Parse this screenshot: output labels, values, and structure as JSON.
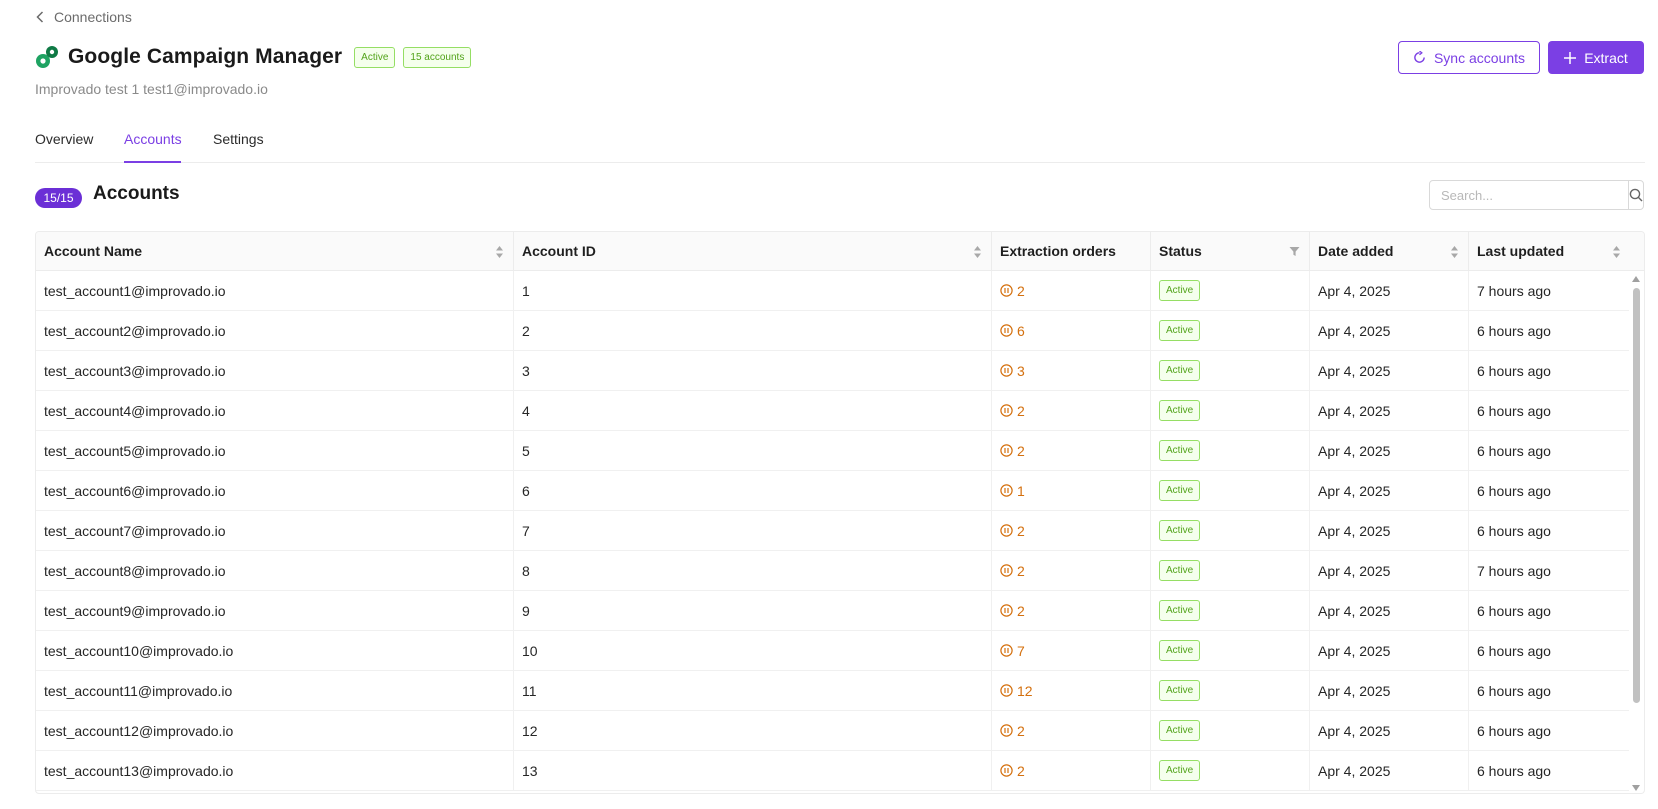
{
  "breadcrumb": {
    "label": "Connections"
  },
  "connector": {
    "title": "Google Campaign Manager",
    "status_badge": "Active",
    "accounts_badge": "15 accounts",
    "subtitle": "Improvado test 1 test1@improvado.io"
  },
  "actions": {
    "sync_label": "Sync accounts",
    "extract_label": "Extract"
  },
  "tabs": [
    {
      "label": "Overview",
      "active": false
    },
    {
      "label": "Accounts",
      "active": true
    },
    {
      "label": "Settings",
      "active": false
    }
  ],
  "section": {
    "count": "15/15",
    "title": "Accounts"
  },
  "search": {
    "placeholder": "Search...",
    "value": ""
  },
  "table": {
    "columns": [
      "Account Name",
      "Account ID",
      "Extraction orders",
      "Status",
      "Date added",
      "Last updated"
    ],
    "rows": [
      {
        "name": "test_account1@improvado.io",
        "id": "1",
        "orders": "2",
        "status": "Active",
        "added": "Apr 4, 2025",
        "updated": "7 hours ago"
      },
      {
        "name": "test_account2@improvado.io",
        "id": "2",
        "orders": "6",
        "status": "Active",
        "added": "Apr 4, 2025",
        "updated": "6 hours ago"
      },
      {
        "name": "test_account3@improvado.io",
        "id": "3",
        "orders": "3",
        "status": "Active",
        "added": "Apr 4, 2025",
        "updated": "6 hours ago"
      },
      {
        "name": "test_account4@improvado.io",
        "id": "4",
        "orders": "2",
        "status": "Active",
        "added": "Apr 4, 2025",
        "updated": "6 hours ago"
      },
      {
        "name": "test_account5@improvado.io",
        "id": "5",
        "orders": "2",
        "status": "Active",
        "added": "Apr 4, 2025",
        "updated": "6 hours ago"
      },
      {
        "name": "test_account6@improvado.io",
        "id": "6",
        "orders": "1",
        "status": "Active",
        "added": "Apr 4, 2025",
        "updated": "6 hours ago"
      },
      {
        "name": "test_account7@improvado.io",
        "id": "7",
        "orders": "2",
        "status": "Active",
        "added": "Apr 4, 2025",
        "updated": "6 hours ago"
      },
      {
        "name": "test_account8@improvado.io",
        "id": "8",
        "orders": "2",
        "status": "Active",
        "added": "Apr 4, 2025",
        "updated": "7 hours ago"
      },
      {
        "name": "test_account9@improvado.io",
        "id": "9",
        "orders": "2",
        "status": "Active",
        "added": "Apr 4, 2025",
        "updated": "6 hours ago"
      },
      {
        "name": "test_account10@improvado.io",
        "id": "10",
        "orders": "7",
        "status": "Active",
        "added": "Apr 4, 2025",
        "updated": "6 hours ago"
      },
      {
        "name": "test_account11@improvado.io",
        "id": "11",
        "orders": "12",
        "status": "Active",
        "added": "Apr 4, 2025",
        "updated": "6 hours ago"
      },
      {
        "name": "test_account12@improvado.io",
        "id": "12",
        "orders": "2",
        "status": "Active",
        "added": "Apr 4, 2025",
        "updated": "6 hours ago"
      },
      {
        "name": "test_account13@improvado.io",
        "id": "13",
        "orders": "2",
        "status": "Active",
        "added": "Apr 4, 2025",
        "updated": "6 hours ago"
      }
    ]
  },
  "colors": {
    "accent": "#7b3fe4",
    "success": "#52a31a",
    "warning": "#d4700e",
    "logo_green": "#1ea362"
  },
  "icons": [
    "chevron-left-icon",
    "campaign-manager-logo",
    "sync-icon",
    "plus-icon",
    "search-icon",
    "sort-icon",
    "filter-icon",
    "pause-circle-icon"
  ]
}
